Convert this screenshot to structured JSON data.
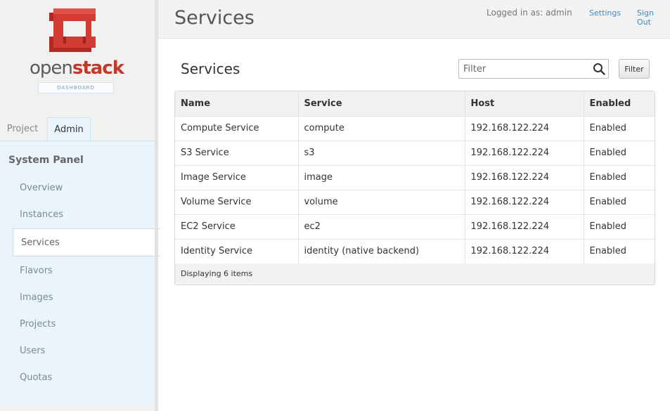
{
  "brand": {
    "logo_open": "open",
    "logo_stack": "stack",
    "badge": "DASHBOARD",
    "colors": {
      "red": "#c0392b",
      "gray": "#5a5a5a"
    }
  },
  "sidebar": {
    "tabs": [
      {
        "label": "Project",
        "active": false
      },
      {
        "label": "Admin",
        "active": true
      }
    ],
    "panel_title": "System Panel",
    "items": [
      {
        "label": "Overview"
      },
      {
        "label": "Instances"
      },
      {
        "label": "Services",
        "active": true
      },
      {
        "label": "Flavors"
      },
      {
        "label": "Images"
      },
      {
        "label": "Projects"
      },
      {
        "label": "Users"
      },
      {
        "label": "Quotas"
      }
    ]
  },
  "header": {
    "title": "Services",
    "logged_in": "Logged in as: admin",
    "settings": "Settings",
    "sign_out": "Sign Out",
    "link_color": "#3d8bc4"
  },
  "main": {
    "title": "Services",
    "filter_placeholder": "Filter",
    "filter_button": "Filter",
    "search_icon": "search-icon"
  },
  "table": {
    "columns": [
      "Name",
      "Service",
      "Host",
      "Enabled"
    ],
    "rows": [
      [
        "Compute Service",
        "compute",
        "192.168.122.224",
        "Enabled"
      ],
      [
        "S3 Service",
        "s3",
        "192.168.122.224",
        "Enabled"
      ],
      [
        "Image Service",
        "image",
        "192.168.122.224",
        "Enabled"
      ],
      [
        "Volume Service",
        "volume",
        "192.168.122.224",
        "Enabled"
      ],
      [
        "EC2 Service",
        "ec2",
        "192.168.122.224",
        "Enabled"
      ],
      [
        "Identity Service",
        "identity (native backend)",
        "192.168.122.224",
        "Enabled"
      ]
    ],
    "footer": "Displaying 6 items"
  }
}
